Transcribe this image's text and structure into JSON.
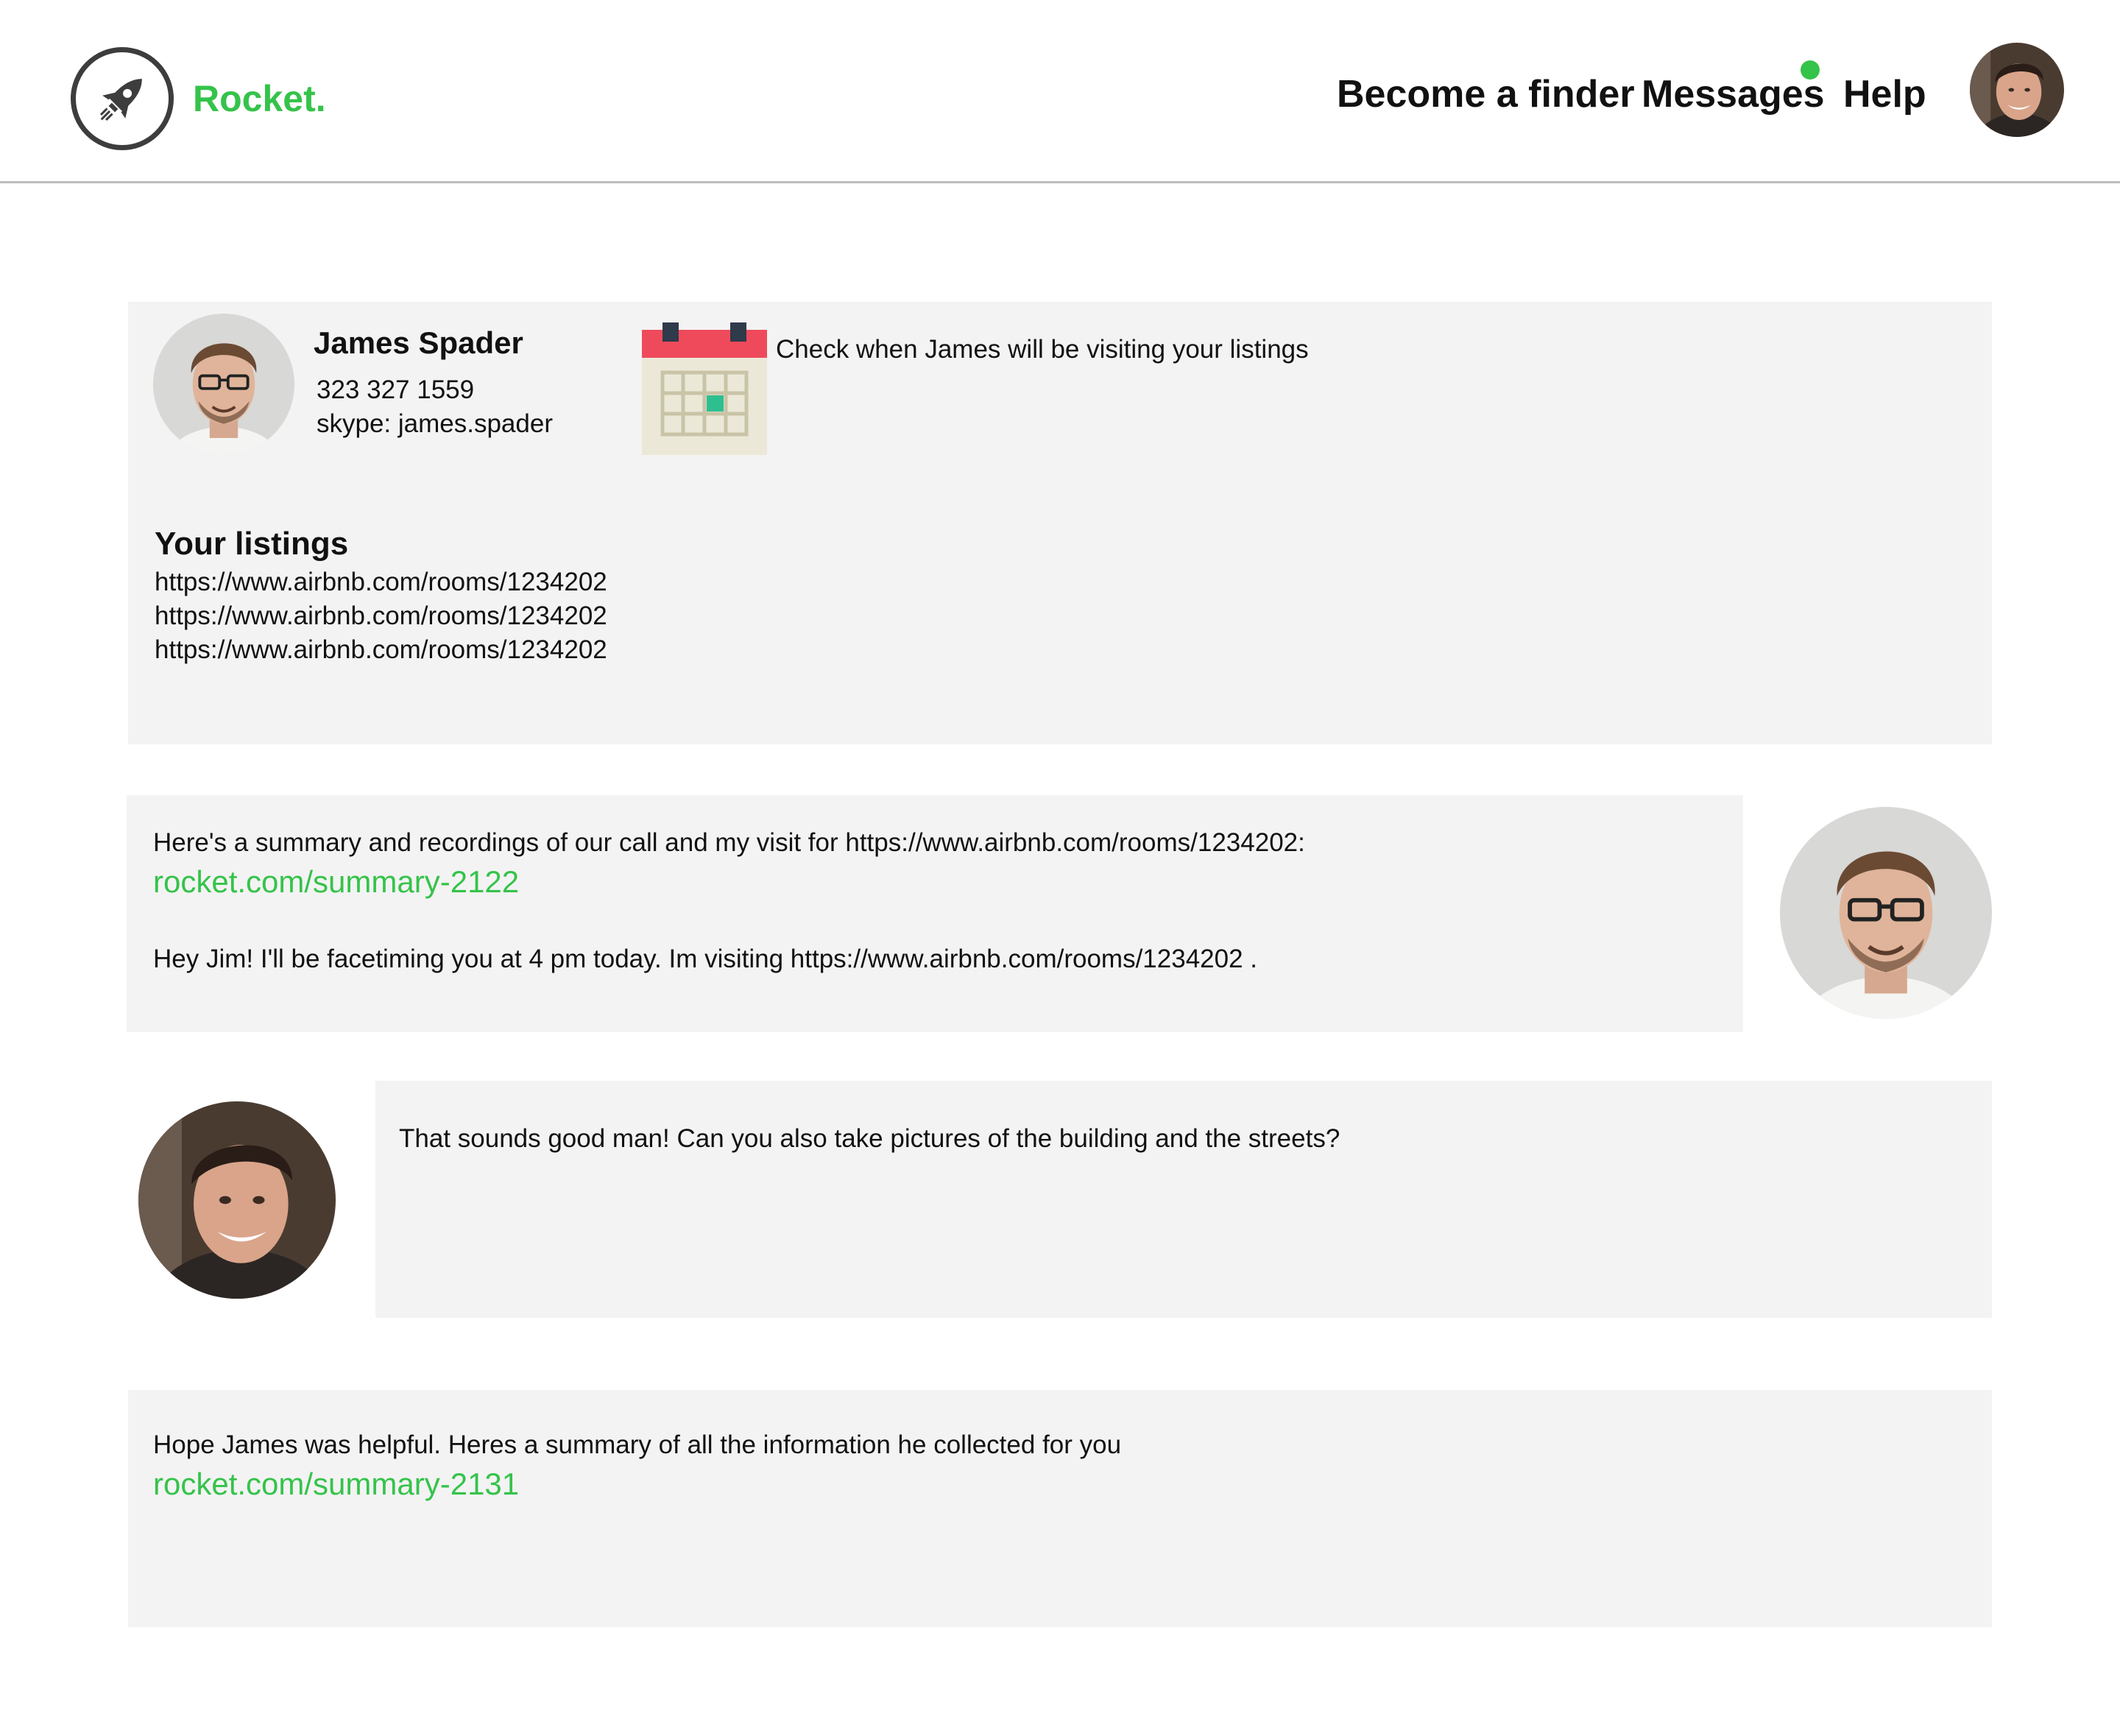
{
  "header": {
    "brand": "Rocket.",
    "nav": {
      "become_finder": "Become a finder",
      "messages": "Messages",
      "help": "Help"
    },
    "logo_icon": "rocket-icon",
    "notification_color": "#35c34a"
  },
  "profile_card": {
    "name": "James Spader",
    "phone": "323 327 1559",
    "skype": "skype: james.spader",
    "calendar_icon": "calendar-icon",
    "calendar_text": "Check when James will be visiting your listings",
    "listings_title": "Your listings",
    "listings": [
      "https://www.airbnb.com/rooms/1234202",
      "https://www.airbnb.com/rooms/1234202",
      "https://www.airbnb.com/rooms/1234202"
    ]
  },
  "messages": [
    {
      "text": "Here's a summary and recordings of our call and my visit for https://www.airbnb.com/rooms/1234202:",
      "link": "rocket.com/summary-2122",
      "text2": "Hey Jim! I'll be facetiming you at 4 pm today. Im visiting https://www.airbnb.com/rooms/1234202 ."
    },
    {
      "text": "That sounds good man! Can you also take pictures of the building and the streets?"
    },
    {
      "text": "Hope James was helpful. Heres a summary of all the information he collected for you",
      "link": "rocket.com/summary-2131"
    }
  ],
  "colors": {
    "accent": "#35c34a",
    "card_bg": "#f3f3f3",
    "calendar_red": "#ef4a5b"
  }
}
